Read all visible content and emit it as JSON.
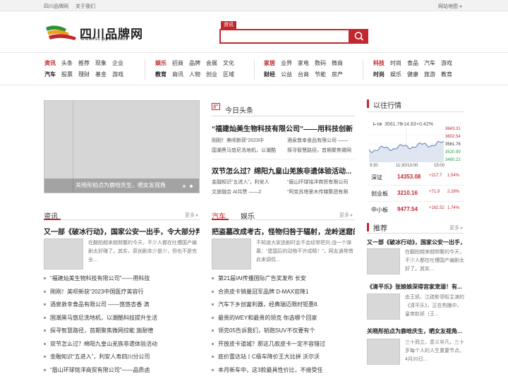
{
  "topbar": {
    "links": [
      "四川品牌网",
      "关于我们"
    ],
    "sitemap": "网站地图"
  },
  "logo": {
    "title": "四川品牌网",
    "url": "www.sc.pp188.net"
  },
  "search": {
    "tab": "资讯"
  },
  "nav": {
    "groups": [
      {
        "rows": [
          [
            {
              "t": "资讯",
              "s": "hl"
            },
            {
              "t": "头条"
            },
            {
              "t": "推荐"
            },
            {
              "t": "现象"
            },
            {
              "t": "企业"
            }
          ],
          [
            {
              "t": "汽车",
              "s": "bd"
            },
            {
              "t": "股票"
            },
            {
              "t": "理财"
            },
            {
              "t": "基金"
            },
            {
              "t": "游戏"
            }
          ]
        ]
      },
      {
        "rows": [
          [
            {
              "t": "娱乐",
              "s": "hl"
            },
            {
              "t": "招商"
            },
            {
              "t": "品牌"
            },
            {
              "t": "会展"
            },
            {
              "t": "文化"
            }
          ],
          [
            {
              "t": "教育",
              "s": "bd"
            },
            {
              "t": "商讯"
            },
            {
              "t": "人物"
            },
            {
              "t": "创业"
            },
            {
              "t": "区域"
            }
          ]
        ]
      },
      {
        "rows": [
          [
            {
              "t": "家居",
              "s": "hl"
            },
            {
              "t": "业界"
            },
            {
              "t": "家电"
            },
            {
              "t": "数码"
            },
            {
              "t": "微商"
            }
          ],
          [
            {
              "t": "财经",
              "s": "bd"
            },
            {
              "t": "公益"
            },
            {
              "t": "台商"
            },
            {
              "t": "节能"
            },
            {
              "t": "房产"
            }
          ]
        ]
      },
      {
        "rows": [
          [
            {
              "t": "科技",
              "s": "hl"
            },
            {
              "t": "时尚"
            },
            {
              "t": "食品"
            },
            {
              "t": "汽车"
            },
            {
              "t": "游戏"
            }
          ],
          [
            {
              "t": "时尚",
              "s": "bd"
            },
            {
              "t": "娱乐"
            },
            {
              "t": "健康"
            },
            {
              "t": "旅游"
            },
            {
              "t": "教育"
            }
          ]
        ]
      }
    ]
  },
  "slider": {
    "caption": "关晓彤拍点为鹿晗庆生，晒女友视角"
  },
  "headline": {
    "title": "今日头条",
    "items": [
      {
        "title": "“福建灿美生物科技有限公司”——用科技创新",
        "subs": [
          [
            "刚刚！美呗新获“2023中",
            "酒泉敦幸食品有限公司 ——"
          ],
          [
            "国潮黑马悠尼洗地机，以潮酷",
            "探寻智慧路径，首期聚焦微网"
          ]
        ]
      },
      {
        "title": "双节怎么过？绵阳九皇山羌族非遗体验活动...",
        "subs": [
          [
            "金融知识“五进入”，利安人",
            "“眉山环球铭洋商贸有限公司"
          ],
          [
            "文旅融合 AI共赞 ——2",
            "“阿克苏塔里木传媒集团有限"
          ]
        ]
      }
    ]
  },
  "market": {
    "title": "以往行情",
    "quote": {
      "name": "上证",
      "value": "3561.76",
      "change": "+14.83",
      "pct": "+0.42%"
    },
    "levels": [
      "3643.31",
      "3602.54",
      "3561.76",
      "3520.99",
      "3480.22"
    ],
    "times": [
      "9:30",
      "11:30/13:00",
      "15:00"
    ],
    "rows": [
      {
        "name": "深证",
        "value": "14353.08",
        "change": "+217.7",
        "pct": "1.54%"
      },
      {
        "name": "创业板",
        "value": "3210.16",
        "change": "+71.9",
        "pct": "2.29%"
      },
      {
        "name": "中小板",
        "value": "9477.54",
        "change": "+162.52",
        "pct": "1.74%"
      }
    ],
    "colors": {
      "up": "#c1272d",
      "down": "#2a9d4b"
    }
  },
  "news": {
    "title": "资讯",
    "more": "更多",
    "lead": "又一部《破冰行动》，国家公安一出手，令大部分判",
    "desc": "在翻拍越来越频繁的今天，不少人都在吐槽国产编剧太好赚了。其实，原创剧本少是少，但也不是完全...",
    "list": [
      "“福建灿美生物科技有限公司”——用科技",
      "刚刚！美呗新获“2023中国医疗美容行",
      "酒泉敦幸食品有限公司 ——悠悠杏香 滴",
      "国潮黑马悠尼洗地机，以潮酷科技提升生活",
      "探寻智慧路径，首期聚焦微网综能 施耐德",
      "双节怎么过？绵阳九皇山羌族非遗体验活动",
      "金融知识“五进入”，利安人寿四川分公司",
      "“眉山环球铭洋商贸有限公司”——品质卤"
    ]
  },
  "auto": {
    "tabs": [
      "汽车",
      "娱乐"
    ],
    "more": "更多",
    "lead": "把盗墓改成考古，怪物归咎于辐射，龙岭迷窟的...",
    "desc": "不知道大家追剧时会不会经常把刘 战一个弹幕：“建国后的动物不许成精！”，网友通常借此来调侃...",
    "list": [
      "第21届IAI传播国际广告奖发布 长安",
      "合资皮卡销量冠军品牌 D-MAX官降1",
      "汽车下乡创富利器，经典瑞迈限时钜惠8.",
      "最贵的WEY和最贵的领克 你选哪个回家",
      "领克05告诉我们，轿跑SUV不仅要有个",
      "开放皮卡道城？那这几款皮卡一定不容错过",
      "底价雷达站丨C级车降价王大比拼 沃尔沃",
      "本月新车中，这3款最具性价比，不接受任"
    ]
  },
  "recommend": {
    "title": "推荐",
    "more": "更多",
    "lead": "又一部《破冰行动》，国家公安一出手，令大部分判",
    "items": [
      {
        "desc": "在翻拍越来越频繁的今天，不少人都在吐槽国产编剧太好了。其实..."
      },
      {
        "title": "《清平乐》张娘娘深得宫家宠溺！有...",
        "desc": "由王凯、江疏影领衔主演的《清平乐》，正在热播中，皇帝赵祯（王..."
      },
      {
        "title": "关晓彤拍点为鹿晗庆生，晒女友视角...",
        "desc": "三十而立，意义非凡，三十岁每个人的人生重要节点。4月20日..."
      }
    ]
  }
}
